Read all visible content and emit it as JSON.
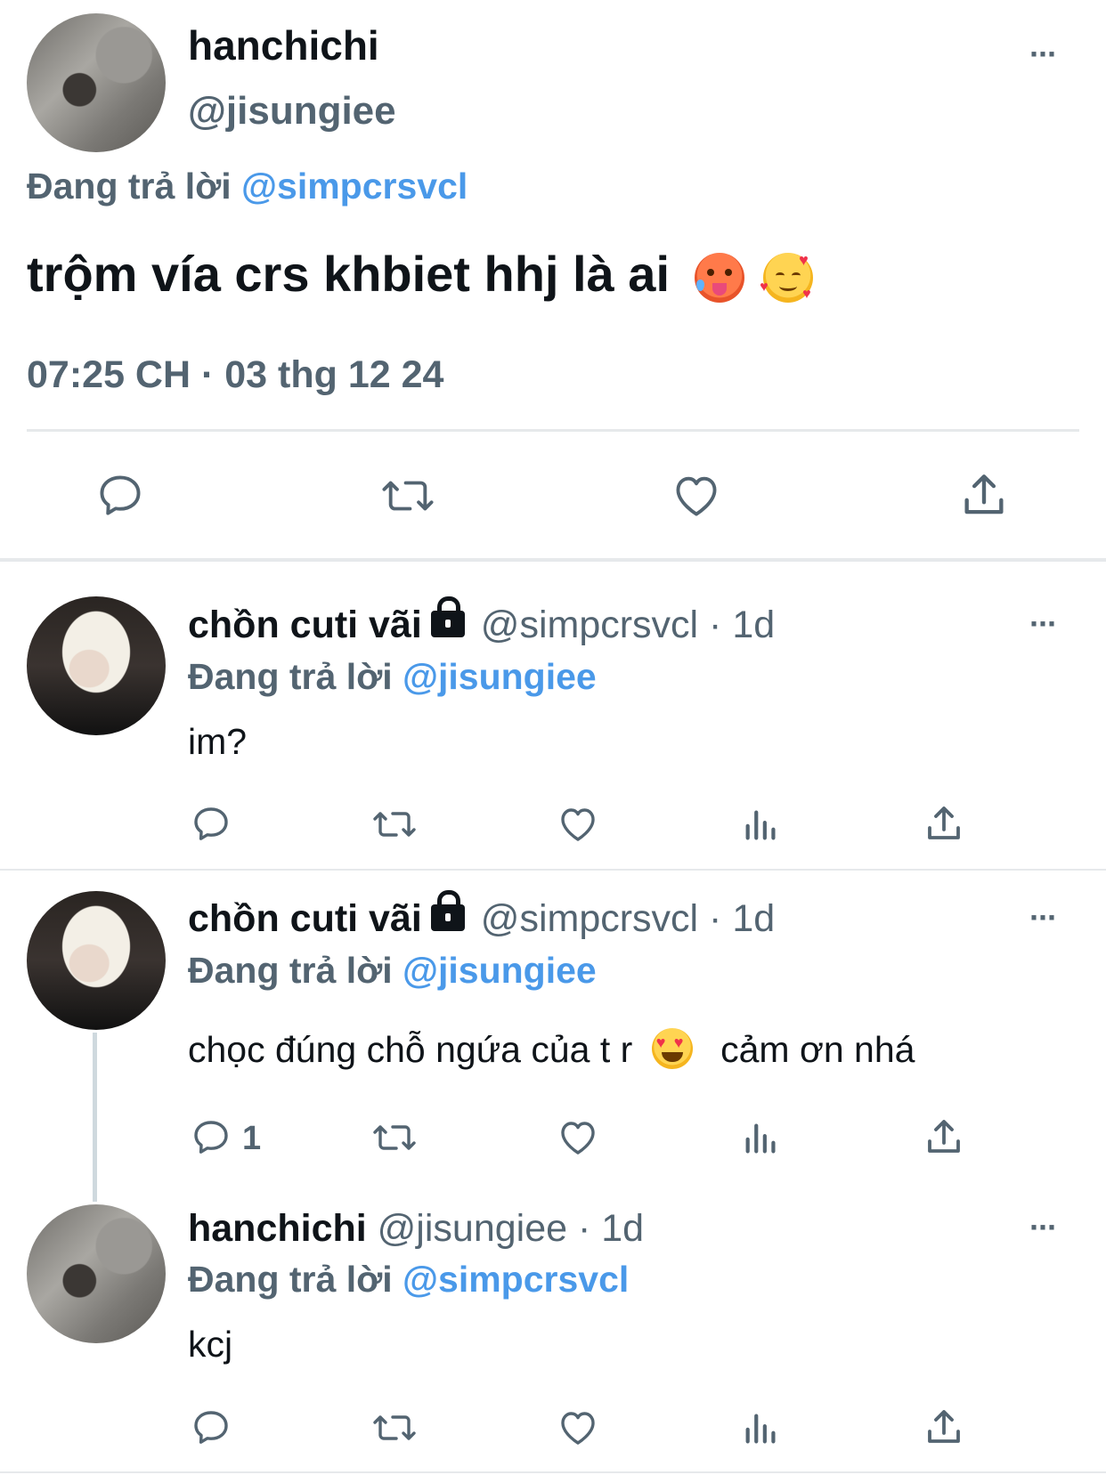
{
  "main_tweet": {
    "name": "hanchichi",
    "handle": "@jisungiee",
    "reply_prefix": "Đang trả lời",
    "reply_to": "@simpcrsvcl",
    "text": "trộm vía crs khbiet hhj là ai",
    "emojis": [
      "hot-face-emoji",
      "smiling-face-with-hearts-emoji"
    ],
    "timestamp": "07:25 CH · 03 thg 12 24",
    "more": "···"
  },
  "replies": [
    {
      "name": "chồn cuti vãi",
      "handle": "@simpcrsvcl · 1d",
      "locked": true,
      "reply_prefix": "Đang trả lời",
      "reply_to": "@jisungiee",
      "text": "im?",
      "reply_count": "",
      "more": "···"
    },
    {
      "name": "chồn cuti vãi",
      "handle": "@simpcrsvcl · 1d",
      "locked": true,
      "reply_prefix": "Đang trả lời",
      "reply_to": "@jisungiee",
      "text_before": "chọc đúng chỗ ngứa của t r",
      "text_after": "cảm ơn nhá",
      "emoji": "heart-eyes-emoji",
      "reply_count": "1",
      "more": "···"
    },
    {
      "name": "hanchichi",
      "handle": "@jisungiee · 1d",
      "locked": false,
      "reply_prefix": "Đang trả lời",
      "reply_to": "@simpcrsvcl",
      "text": "kcj",
      "reply_count": "",
      "more": "···"
    }
  ],
  "colors": {
    "accent": "#4a99e9",
    "secondary_text": "#536471",
    "divider": "#e6e9eb"
  },
  "icons": [
    "reply-icon",
    "retweet-icon",
    "like-icon",
    "views-icon",
    "share-icon"
  ]
}
